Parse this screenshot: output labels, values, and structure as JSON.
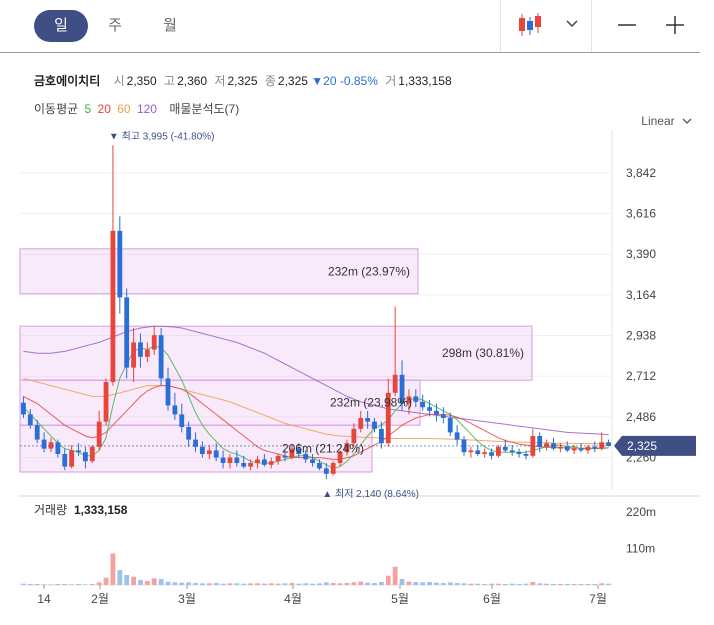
{
  "toolbar": {
    "tabs": [
      "일",
      "주",
      "월"
    ],
    "active_tab": "일",
    "icons": [
      "candlestick-icon",
      "chevron-down-icon",
      "minus-icon",
      "plus-icon"
    ]
  },
  "stock": {
    "name": "금호에이치티",
    "open_label": "시",
    "open": "2,350",
    "high_label": "고",
    "high": "2,360",
    "low_label": "저",
    "low": "2,325",
    "close_label": "종",
    "close": "2,325",
    "change": "▼20 -0.85%",
    "volume_label": "거",
    "volume": "1,333,158"
  },
  "ma": {
    "label": "이동평균",
    "periods": [
      {
        "value": "5",
        "color": "#3db54a"
      },
      {
        "value": "20",
        "color": "#e8453c"
      },
      {
        "value": "60",
        "color": "#f19b4a"
      },
      {
        "value": "120",
        "color": "#9b59c9"
      }
    ],
    "analysis": "매물분석도(7)"
  },
  "scale_label": "Linear",
  "colors": {
    "up": "#e8453c",
    "down": "#2a6ed6",
    "accent": "#3f4f86"
  },
  "chart_data": {
    "type": "candlestick",
    "y_ticks": [
      "3,842",
      "3,616",
      "3,390",
      "3,164",
      "2,938",
      "2,712",
      "2,486",
      "2,260"
    ],
    "y_tick_values": [
      3842,
      3616,
      3390,
      3164,
      2938,
      2712,
      2486,
      2260
    ],
    "x_ticks": [
      "14",
      "2월",
      "3월",
      "4월",
      "5월",
      "6월",
      "7월"
    ],
    "last_price": "2,325",
    "high_marker": "최고 3,995 (-41.80%)",
    "low_marker": "최저 2,140 (8.64%)",
    "volume_profile": [
      {
        "label": "232m (23.97%)",
        "low": 3170,
        "high": 3420
      },
      {
        "label": "298m (30.81%)",
        "low": 2690,
        "high": 2990
      },
      {
        "label": "232m (23.98%)",
        "low": 2440,
        "high": 2690
      },
      {
        "label": "206m (21.24%)",
        "low": 2180,
        "high": 2440
      }
    ],
    "ohlc": [
      [
        2565,
        2600,
        2480,
        2500
      ],
      [
        2500,
        2530,
        2420,
        2440
      ],
      [
        2440,
        2470,
        2340,
        2360
      ],
      [
        2360,
        2400,
        2290,
        2310
      ],
      [
        2310,
        2370,
        2290,
        2345
      ],
      [
        2345,
        2360,
        2260,
        2280
      ],
      [
        2280,
        2310,
        2190,
        2210
      ],
      [
        2210,
        2330,
        2200,
        2300
      ],
      [
        2300,
        2340,
        2270,
        2290
      ],
      [
        2290,
        2320,
        2200,
        2240
      ],
      [
        2240,
        2330,
        2230,
        2320
      ],
      [
        2320,
        2520,
        2300,
        2460
      ],
      [
        2460,
        2700,
        2440,
        2680
      ],
      [
        2680,
        3995,
        2660,
        3520
      ],
      [
        3520,
        3600,
        3060,
        3150
      ],
      [
        3150,
        3200,
        2700,
        2760
      ],
      [
        2760,
        2980,
        2680,
        2900
      ],
      [
        2900,
        2950,
        2760,
        2820
      ],
      [
        2820,
        2900,
        2790,
        2860
      ],
      [
        2860,
        2990,
        2830,
        2940
      ],
      [
        2940,
        2980,
        2660,
        2700
      ],
      [
        2700,
        2760,
        2520,
        2550
      ],
      [
        2550,
        2620,
        2470,
        2500
      ],
      [
        2500,
        2560,
        2400,
        2430
      ],
      [
        2430,
        2460,
        2320,
        2360
      ],
      [
        2360,
        2400,
        2290,
        2320
      ],
      [
        2320,
        2350,
        2260,
        2280
      ],
      [
        2280,
        2330,
        2250,
        2300
      ],
      [
        2300,
        2340,
        2240,
        2260
      ],
      [
        2260,
        2300,
        2200,
        2230
      ],
      [
        2230,
        2280,
        2200,
        2260
      ],
      [
        2260,
        2300,
        2210,
        2230
      ],
      [
        2230,
        2270,
        2200,
        2210
      ],
      [
        2210,
        2250,
        2190,
        2230
      ],
      [
        2230,
        2270,
        2200,
        2250
      ],
      [
        2250,
        2280,
        2210,
        2220
      ],
      [
        2220,
        2260,
        2200,
        2240
      ],
      [
        2240,
        2280,
        2220,
        2270
      ],
      [
        2270,
        2300,
        2240,
        2260
      ],
      [
        2260,
        2330,
        2250,
        2310
      ],
      [
        2310,
        2340,
        2260,
        2280
      ],
      [
        2280,
        2300,
        2230,
        2250
      ],
      [
        2250,
        2280,
        2210,
        2230
      ],
      [
        2230,
        2250,
        2190,
        2200
      ],
      [
        2200,
        2230,
        2140,
        2170
      ],
      [
        2170,
        2240,
        2160,
        2230
      ],
      [
        2230,
        2300,
        2210,
        2290
      ],
      [
        2290,
        2360,
        2270,
        2340
      ],
      [
        2340,
        2450,
        2320,
        2420
      ],
      [
        2420,
        2520,
        2400,
        2480
      ],
      [
        2480,
        2520,
        2420,
        2460
      ],
      [
        2460,
        2480,
        2400,
        2420
      ],
      [
        2420,
        2460,
        2310,
        2340
      ],
      [
        2340,
        2700,
        2320,
        2620
      ],
      [
        2620,
        3100,
        2600,
        2720
      ],
      [
        2720,
        2800,
        2520,
        2560
      ],
      [
        2560,
        2640,
        2500,
        2600
      ],
      [
        2600,
        2640,
        2540,
        2570
      ],
      [
        2570,
        2610,
        2520,
        2540
      ],
      [
        2540,
        2580,
        2490,
        2520
      ],
      [
        2520,
        2560,
        2460,
        2500
      ],
      [
        2500,
        2540,
        2450,
        2480
      ],
      [
        2480,
        2510,
        2380,
        2400
      ],
      [
        2400,
        2440,
        2330,
        2360
      ],
      [
        2360,
        2380,
        2270,
        2290
      ],
      [
        2290,
        2320,
        2260,
        2300
      ],
      [
        2300,
        2330,
        2270,
        2280
      ],
      [
        2280,
        2310,
        2260,
        2290
      ],
      [
        2290,
        2310,
        2250,
        2270
      ],
      [
        2270,
        2330,
        2260,
        2320
      ],
      [
        2320,
        2360,
        2290,
        2300
      ],
      [
        2300,
        2330,
        2270,
        2290
      ],
      [
        2290,
        2310,
        2260,
        2280
      ],
      [
        2280,
        2300,
        2250,
        2270
      ],
      [
        2270,
        2420,
        2260,
        2380
      ],
      [
        2380,
        2400,
        2290,
        2320
      ],
      [
        2320,
        2360,
        2300,
        2340
      ],
      [
        2340,
        2370,
        2300,
        2310
      ],
      [
        2310,
        2340,
        2290,
        2320
      ],
      [
        2320,
        2350,
        2290,
        2300
      ],
      [
        2300,
        2330,
        2280,
        2310
      ],
      [
        2310,
        2340,
        2290,
        2300
      ],
      [
        2300,
        2330,
        2280,
        2320
      ],
      [
        2320,
        2350,
        2290,
        2310
      ],
      [
        2310,
        2400,
        2300,
        2345
      ],
      [
        2345,
        2360,
        2325,
        2325
      ]
    ],
    "ma5": [
      2540,
      2500,
      2460,
      2420,
      2380,
      2340,
      2310,
      2300,
      2290,
      2270,
      2270,
      2300,
      2370,
      2550,
      2700,
      2780,
      2850,
      2870,
      2860,
      2880,
      2870,
      2830,
      2760,
      2690,
      2600,
      2510,
      2440,
      2390,
      2350,
      2310,
      2290,
      2280,
      2260,
      2240,
      2230,
      2230,
      2230,
      2240,
      2250,
      2260,
      2270,
      2270,
      2260,
      2240,
      2220,
      2200,
      2210,
      2240,
      2280,
      2330,
      2380,
      2420,
      2440,
      2470,
      2520,
      2560,
      2580,
      2590,
      2580,
      2560,
      2540,
      2520,
      2500,
      2470,
      2430,
      2390,
      2350,
      2320,
      2300,
      2290,
      2290,
      2290,
      2290,
      2290,
      2300,
      2310,
      2320,
      2330,
      2330,
      2320,
      2320,
      2310,
      2310,
      2310,
      2310,
      2315
    ],
    "ma20": [
      2600,
      2580,
      2560,
      2530,
      2500,
      2470,
      2440,
      2420,
      2400,
      2380,
      2370,
      2380,
      2400,
      2440,
      2480,
      2520,
      2560,
      2600,
      2630,
      2650,
      2660,
      2660,
      2650,
      2640,
      2620,
      2590,
      2560,
      2530,
      2500,
      2470,
      2440,
      2410,
      2380,
      2350,
      2320,
      2300,
      2290,
      2280,
      2270,
      2260,
      2260,
      2260,
      2260,
      2260,
      2255,
      2250,
      2250,
      2260,
      2270,
      2290,
      2310,
      2330,
      2350,
      2380,
      2410,
      2440,
      2460,
      2480,
      2490,
      2500,
      2500,
      2500,
      2495,
      2485,
      2470,
      2450,
      2430,
      2410,
      2390,
      2370,
      2355,
      2345,
      2335,
      2330,
      2325,
      2320,
      2318,
      2316,
      2315,
      2314,
      2313,
      2312,
      2312,
      2312,
      2313,
      2314
    ],
    "ma60": [
      2700,
      2690,
      2680,
      2670,
      2660,
      2650,
      2640,
      2630,
      2620,
      2610,
      2600,
      2600,
      2600,
      2610,
      2620,
      2630,
      2640,
      2650,
      2660,
      2660,
      2660,
      2660,
      2650,
      2640,
      2630,
      2620,
      2610,
      2600,
      2590,
      2580,
      2570,
      2555,
      2540,
      2525,
      2510,
      2495,
      2480,
      2465,
      2450,
      2440,
      2430,
      2420,
      2410,
      2400,
      2390,
      2385,
      2380,
      2378,
      2376,
      2374,
      2372,
      2370,
      2368,
      2367,
      2366,
      2366,
      2366,
      2366,
      2366,
      2366,
      2365,
      2364,
      2363,
      2362,
      2360,
      2358,
      2356,
      2354,
      2352,
      2350,
      2348,
      2347,
      2346,
      2345,
      2344,
      2343,
      2342,
      2341,
      2340,
      2340,
      2339,
      2338,
      2338,
      2338,
      2338,
      2338
    ],
    "ma120": [
      2850,
      2845,
      2840,
      2840,
      2840,
      2845,
      2850,
      2860,
      2870,
      2880,
      2890,
      2900,
      2915,
      2930,
      2945,
      2960,
      2970,
      2980,
      2985,
      2990,
      2990,
      2988,
      2985,
      2980,
      2970,
      2960,
      2950,
      2940,
      2930,
      2920,
      2910,
      2900,
      2885,
      2870,
      2855,
      2840,
      2820,
      2800,
      2780,
      2760,
      2740,
      2720,
      2700,
      2680,
      2660,
      2640,
      2620,
      2600,
      2585,
      2570,
      2560,
      2550,
      2540,
      2530,
      2525,
      2520,
      2515,
      2510,
      2505,
      2500,
      2495,
      2490,
      2485,
      2480,
      2475,
      2470,
      2465,
      2460,
      2455,
      2450,
      2445,
      2440,
      2435,
      2430,
      2425,
      2420,
      2415,
      2410,
      2405,
      2400,
      2398,
      2396,
      2394,
      2392,
      2390,
      2388
    ],
    "volume": [
      4,
      3,
      3,
      2,
      2,
      3,
      3,
      2,
      3,
      2,
      3,
      8,
      22,
      95,
      45,
      30,
      25,
      15,
      12,
      20,
      18,
      10,
      8,
      7,
      8,
      6,
      5,
      5,
      6,
      4,
      5,
      5,
      4,
      5,
      5,
      4,
      5,
      4,
      5,
      6,
      4,
      5,
      4,
      5,
      8,
      6,
      5,
      6,
      8,
      10,
      7,
      6,
      9,
      28,
      55,
      18,
      10,
      9,
      8,
      9,
      7,
      6,
      8,
      6,
      5,
      4,
      4,
      3,
      4,
      4,
      3,
      4,
      3,
      4,
      9,
      5,
      4,
      3,
      3,
      3,
      3,
      3,
      3,
      3,
      5,
      4
    ],
    "volume_ticks": [
      "220m",
      "110m"
    ],
    "volume_label": "거래량",
    "volume_last": "1,333,158"
  }
}
